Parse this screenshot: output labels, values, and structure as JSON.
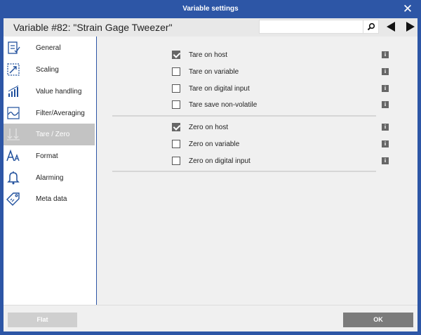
{
  "window": {
    "title": "Variable settings"
  },
  "header": {
    "title": "Variable #82: \"Strain Gage Tweezer\"",
    "search_value": ""
  },
  "sidebar": {
    "items": [
      {
        "label": "General",
        "icon": "general-icon"
      },
      {
        "label": "Scaling",
        "icon": "scaling-icon"
      },
      {
        "label": "Value handling",
        "icon": "value-handling-icon"
      },
      {
        "label": "Filter/Averaging",
        "icon": "filter-icon"
      },
      {
        "label": "Tare / Zero",
        "icon": "tare-icon",
        "active": true
      },
      {
        "label": "Format",
        "icon": "format-icon"
      },
      {
        "label": "Alarming",
        "icon": "bell-icon"
      },
      {
        "label": "Meta data",
        "icon": "tag-icon"
      }
    ]
  },
  "tare": {
    "items": [
      {
        "label": "Tare on host",
        "checked": true
      },
      {
        "label": "Tare on variable",
        "checked": false
      },
      {
        "label": "Tare on digital input",
        "checked": false
      },
      {
        "label": "Tare save non-volatile",
        "checked": false
      }
    ]
  },
  "zero": {
    "items": [
      {
        "label": "Zero on host",
        "checked": true
      },
      {
        "label": "Zero on variable",
        "checked": false
      },
      {
        "label": "Zero on digital input",
        "checked": false
      }
    ]
  },
  "info_glyph": "i",
  "footer": {
    "flat_label": "Flat",
    "ok_label": "OK"
  },
  "colors": {
    "titlebar": "#2d56a6",
    "active_item": "#c3c3c3",
    "icon_blue": "#1f4f9c"
  }
}
